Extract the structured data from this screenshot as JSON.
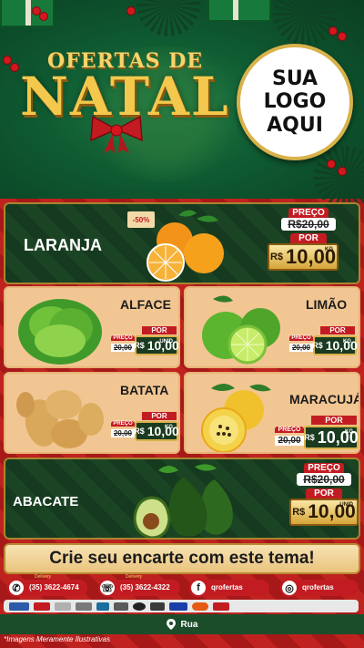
{
  "header": {
    "title_top": "OFERTAS DE",
    "title_main": "NATAL",
    "logo_line1": "SUA",
    "logo_line2": "LOGO",
    "logo_line3": "AQUI"
  },
  "products": {
    "laranja": {
      "name": "LARANJA",
      "badge": "-50%",
      "preco_label": "PREÇO",
      "old_price": "R$20,00",
      "por_label": "POR",
      "currency": "R$",
      "new_price": "10,00",
      "unit": "KG"
    },
    "alface": {
      "name": "ALFACE",
      "preco_label": "PREÇO",
      "old_price": "20,00",
      "por_label": "POR",
      "currency": "R$",
      "new_price": "10,00",
      "unit": "UNID"
    },
    "limao": {
      "name": "LIMÃO",
      "preco_label": "PREÇO",
      "old_price": "20,00",
      "por_label": "POR",
      "currency": "R$",
      "new_price": "10,00",
      "unit": "KG"
    },
    "batata": {
      "name": "BATATA",
      "preco_label": "PREÇO",
      "old_price": "20,00",
      "por_label": "POR",
      "currency": "R$",
      "new_price": "10,00",
      "unit": "KG"
    },
    "maracuja": {
      "name": "MARACUJÁ",
      "preco_label": "PREÇO",
      "old_price": "20,00",
      "por_label": "POR",
      "currency": "R$",
      "new_price": "10,00",
      "unit": "KG"
    },
    "abacate": {
      "name": "ABACATE",
      "preco_label": "PREÇO",
      "old_price": "R$20,00",
      "por_label": "POR",
      "currency": "R$",
      "new_price": "10,00",
      "unit": "UNID"
    }
  },
  "banner": {
    "text": "Crie seu encarte com este tema!"
  },
  "contacts": {
    "whatsapp_label": "Delivery",
    "whatsapp_phone": "(35) 3622-4674",
    "phone_label": "Delivery",
    "phone_number": "(35) 3622-4322",
    "facebook": "qrofertas",
    "instagram": "qrofertas"
  },
  "address": {
    "text": "Rua"
  },
  "disclaimer": "*Imagens Meramente Ilustrativas",
  "colors": {
    "primary_red": "#c21c22",
    "dark_green": "#163a1f",
    "gold": "#d9b24a",
    "cream": "#f2c692"
  }
}
